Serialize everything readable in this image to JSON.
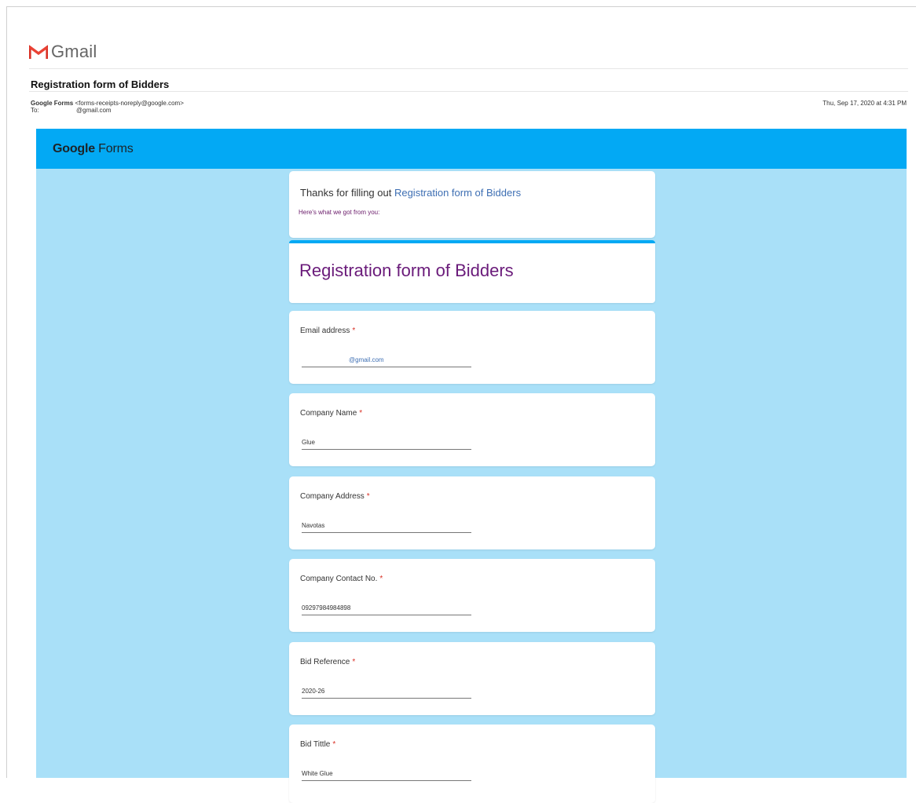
{
  "gmail": {
    "brand": "Gmail",
    "logo_icon": "gmail-m-icon"
  },
  "email": {
    "subject": "Registration form of Bidders",
    "sender_name": "Google Forms",
    "sender_address": "<forms-receipts-noreply@google.com>",
    "to_label": "To:",
    "to_address": "@gmail.com",
    "date": "Thu, Sep 17, 2020 at 4:31 PM"
  },
  "forms_header": {
    "logo_bold": "Google",
    "logo_light": "Forms"
  },
  "thanks": {
    "prefix": "Thanks for filling out ",
    "form_link": "Registration form of Bidders",
    "subtitle": "Here's what we got from you:"
  },
  "form": {
    "title": "Registration form of Bidders"
  },
  "questions": [
    {
      "label": "Email address",
      "required": "*",
      "answer": "@gmail.com"
    },
    {
      "label": "Company Name",
      "required": "*",
      "answer": "Glue"
    },
    {
      "label": "Company Address",
      "required": "*",
      "answer": "Navotas"
    },
    {
      "label": "Company Contact No.",
      "required": "*",
      "answer": "09297984984898"
    },
    {
      "label": "Bid Reference",
      "required": "*",
      "answer": "2020-26"
    },
    {
      "label": "Bid Tittle",
      "required": "*",
      "answer": "White Glue"
    }
  ],
  "colors": {
    "forms_bar": "#03a9f4",
    "forms_body": "#a9e0f8",
    "form_title": "#6a1b7a",
    "link": "#3e6fb3",
    "required": "#d93025"
  }
}
